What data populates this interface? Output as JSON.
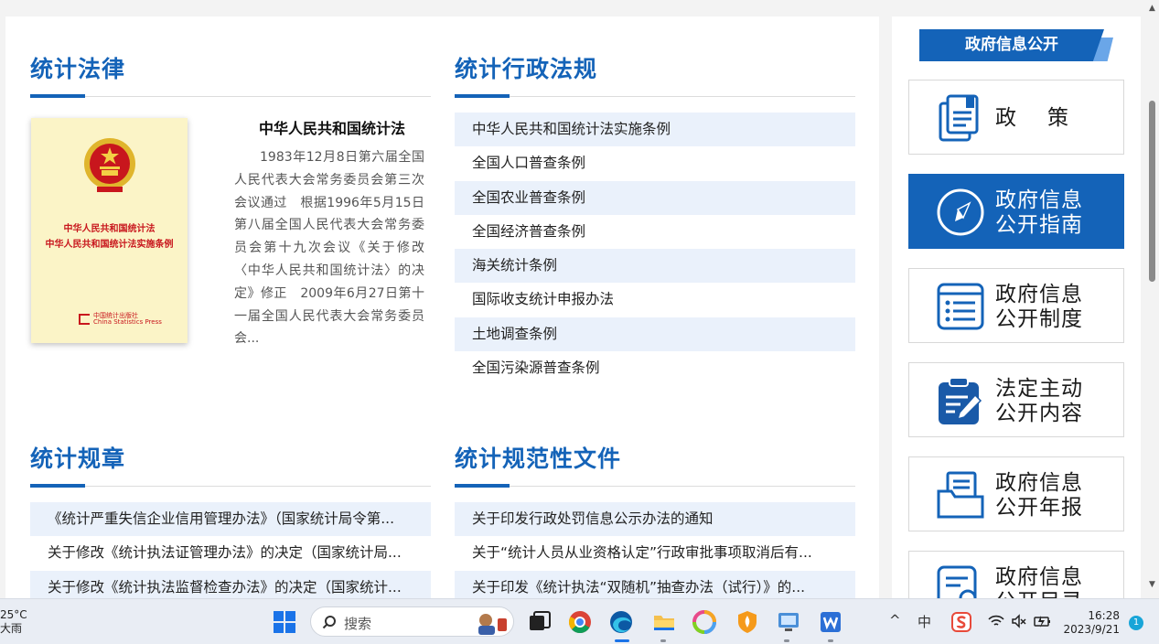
{
  "sections": {
    "laws": {
      "title": "统计法律",
      "book": {
        "cover_line1": "中华人民共和国统计法",
        "cover_line2": "中华人民共和国统计法实施条例",
        "press_cn": "中国统计出版社",
        "press_en": "China Statistics Press"
      },
      "featured_title": "中华人民共和国统计法",
      "featured_desc": "1983年12月8日第六届全国人民代表大会常务委员会第三次会议通过　根据1996年5月15日第八届全国人民代表大会常务委员会第十九次会议《关于修改〈中华人民共和国统计法〉的决定》修正　2009年6月27日第十一届全国人民代表大会常务委员会..."
    },
    "regulations": {
      "title": "统计行政法规",
      "items": [
        "中华人民共和国统计法实施条例",
        "全国人口普查条例",
        "全国农业普查条例",
        "全国经济普查条例",
        "海关统计条例",
        "国际收支统计申报办法",
        "土地调查条例",
        "全国污染源普查条例"
      ]
    },
    "rules": {
      "title": "统计规章",
      "items": [
        "《统计严重失信企业信用管理办法》（国家统计局令第...",
        "关于修改《统计执法证管理办法》的决定（国家统计局...",
        "关于修改《统计执法监督检查办法》的决定（国家统计..."
      ]
    },
    "normative": {
      "title": "统计规范性文件",
      "items": [
        "关于印发行政处罚信息公示办法的通知",
        "关于“统计人员从业资格认定”行政审批事项取消后有...",
        "关于印发《统计执法“双随机”抽查办法（试行）》的..."
      ]
    }
  },
  "sidebar": {
    "banner": "政府信息公开",
    "cards": [
      {
        "line1": "政",
        "line2": "策",
        "icon": "document-icon"
      },
      {
        "line1": "政府信息",
        "line2": "公开指南",
        "icon": "compass-icon"
      },
      {
        "line1": "政府信息",
        "line2": "公开制度",
        "icon": "list-icon"
      },
      {
        "line1": "法定主动",
        "line2": "公开内容",
        "icon": "clipboard-edit-icon"
      },
      {
        "line1": "政府信息",
        "line2": "公开年报",
        "icon": "folder-report-icon"
      },
      {
        "line1": "政府信息",
        "line2": "公开目录",
        "icon": "search-document-icon"
      }
    ]
  },
  "taskbar": {
    "weather_temp": "25°C",
    "weather_desc": "大雨",
    "search_placeholder": "搜索",
    "ime_label": "中",
    "time": "16:28",
    "date": "2023/9/21",
    "notification_count": "1"
  },
  "colors": {
    "accent": "#1463b8",
    "stripe": "#eaf1fb",
    "cover": "#fbf4c7",
    "cover_text": "#c8161d"
  }
}
